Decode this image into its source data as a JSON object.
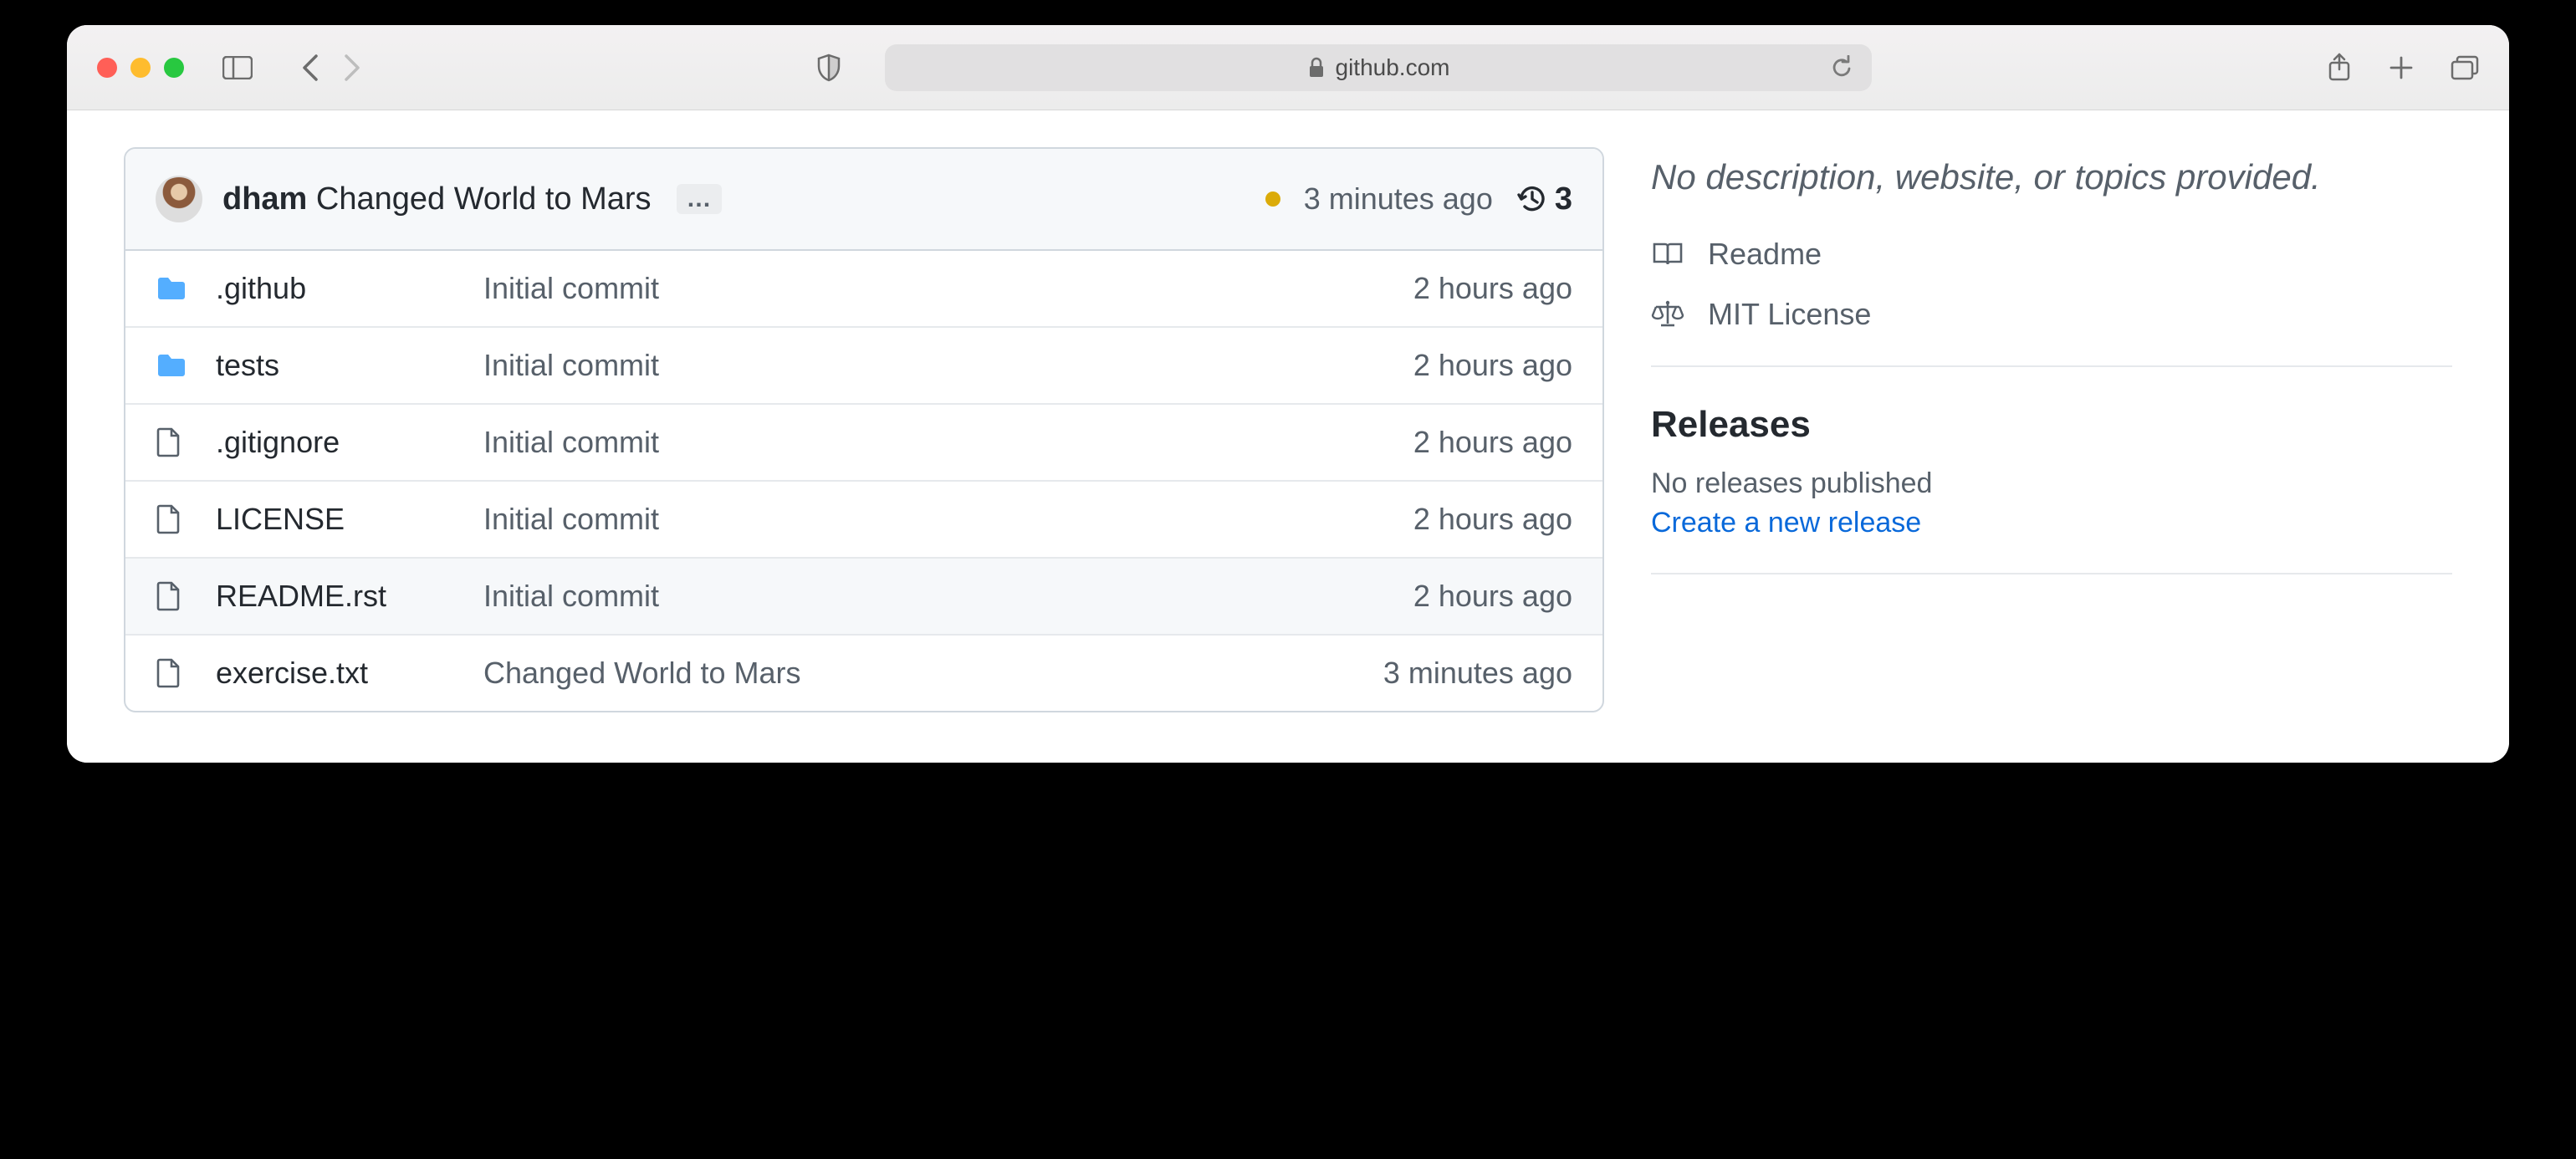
{
  "browser": {
    "url_host": "github.com"
  },
  "commit": {
    "author": "dham",
    "message": "Changed World to Mars",
    "time": "3 minutes ago",
    "status": "pending",
    "history_count": "3"
  },
  "files": [
    {
      "type": "dir",
      "name": ".github",
      "msg": "Initial commit",
      "time": "2 hours ago",
      "hover": false
    },
    {
      "type": "dir",
      "name": "tests",
      "msg": "Initial commit",
      "time": "2 hours ago",
      "hover": false
    },
    {
      "type": "file",
      "name": ".gitignore",
      "msg": "Initial commit",
      "time": "2 hours ago",
      "hover": false
    },
    {
      "type": "file",
      "name": "LICENSE",
      "msg": "Initial commit",
      "time": "2 hours ago",
      "hover": false
    },
    {
      "type": "file",
      "name": "README.rst",
      "msg": "Initial commit",
      "time": "2 hours ago",
      "hover": true
    },
    {
      "type": "file",
      "name": "exercise.txt",
      "msg": "Changed World to Mars",
      "time": "3 minutes ago",
      "hover": false
    }
  ],
  "sidebar": {
    "about": "No description, website, or topics provided.",
    "readme": "Readme",
    "license": "MIT License",
    "releases_heading": "Releases",
    "releases_none": "No releases published",
    "releases_create": "Create a new release"
  }
}
